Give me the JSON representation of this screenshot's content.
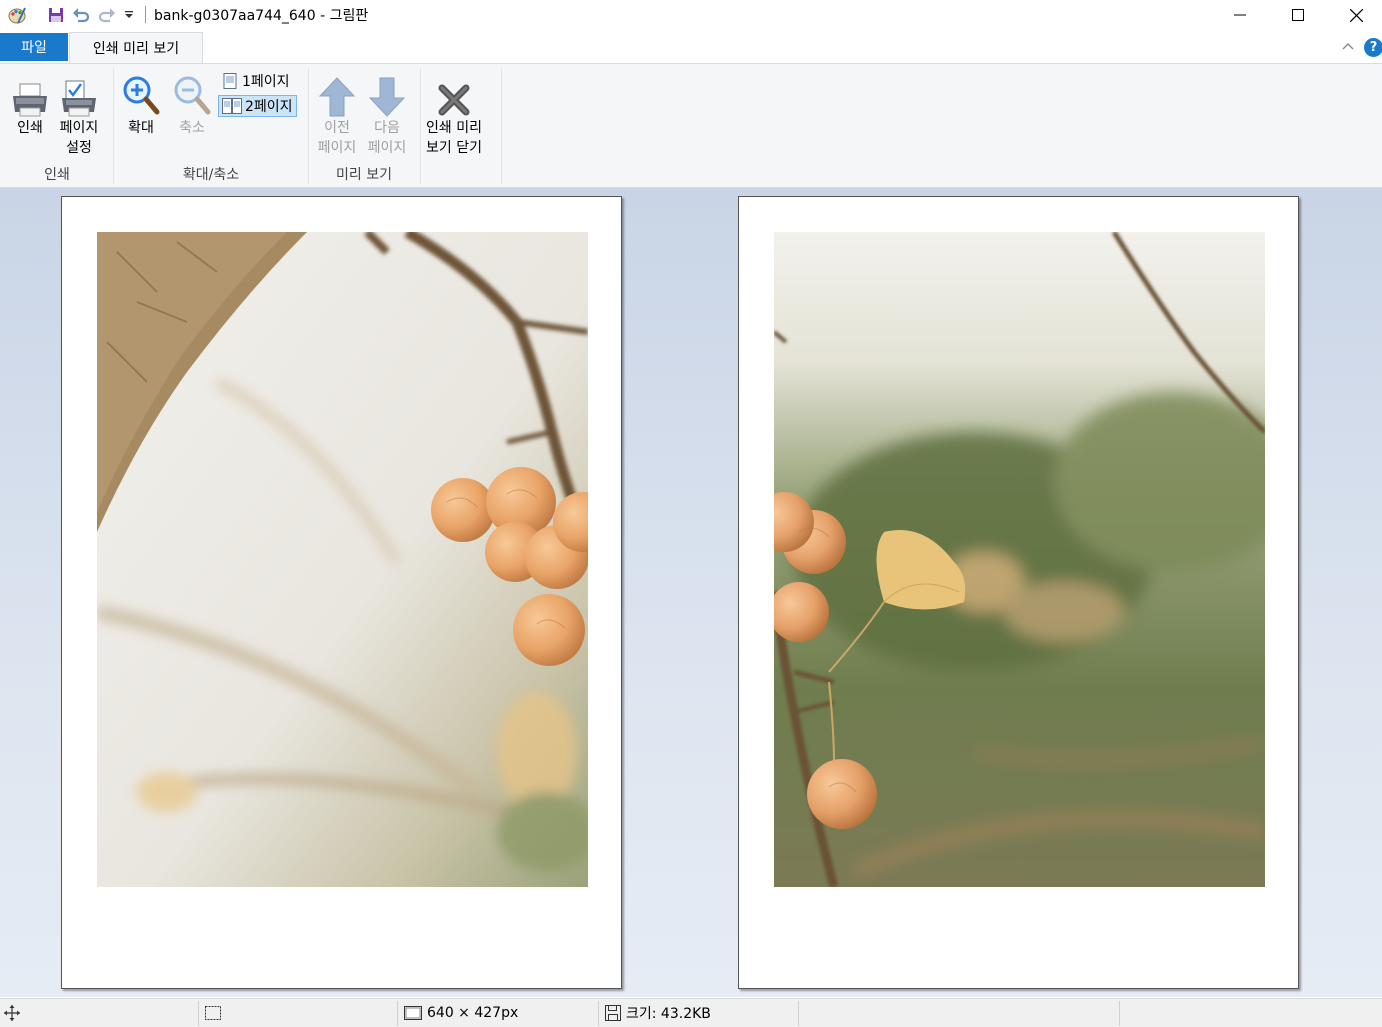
{
  "window": {
    "title": "bank-g0307aa744_640 - 그림판",
    "quick_access": [
      "paint-app-icon",
      "save-icon",
      "undo-icon",
      "redo-icon",
      "customize-dropdown-icon"
    ],
    "controls": [
      "minimize-icon",
      "maximize-icon",
      "close-icon"
    ]
  },
  "tabs": {
    "file": "파일",
    "print_preview": "인쇄 미리 보기",
    "help": "?"
  },
  "ribbon": {
    "print_group": {
      "label": "인쇄",
      "print_button": "인쇄",
      "page_setup_line1": "페이지",
      "page_setup_line2": "설정"
    },
    "zoom_group": {
      "label": "확대/축소",
      "zoom_in": "확대",
      "zoom_out": "축소",
      "one_page": "1페이지",
      "two_pages": "2페이지",
      "selected": "2페이지"
    },
    "preview_group": {
      "label": "미리 보기",
      "prev_line1": "이전",
      "prev_line2": "페이지",
      "next_line1": "다음",
      "next_line2": "페이지"
    },
    "close_group": {
      "close_line1": "인쇄 미리",
      "close_line2": "보기 닫기"
    }
  },
  "preview": {
    "pages": 2
  },
  "status": {
    "dimensions": "640 × 427px",
    "size": "크기: 43.2KB"
  },
  "colors": {
    "accent": "#1979ca",
    "ribbon_bg": "#f5f6f7",
    "preview_bg": "#c9d4e6",
    "selected_bg": "#cce4f7"
  }
}
